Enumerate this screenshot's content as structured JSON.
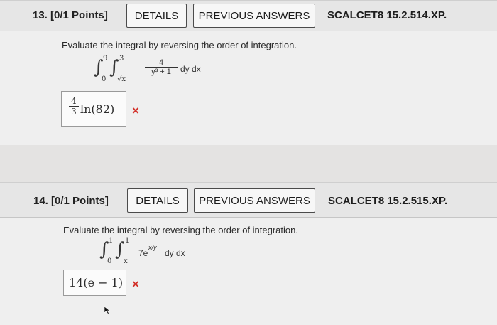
{
  "questions": [
    {
      "title": "13. [0/1 Points]",
      "details_label": "DETAILS",
      "prev_label": "PREVIOUS ANSWERS",
      "code": "SCALCET8 15.2.514.XP.",
      "prompt": "Evaluate the integral by reversing the order of integration.",
      "integral": {
        "outer_upper": "9",
        "outer_lower": "0",
        "inner_upper": "3",
        "inner_lower": "√x",
        "numerator": "4",
        "denominator": "y³ + 1",
        "differentials": "dy dx"
      },
      "answer": {
        "coef_num": "4",
        "coef_den": "3",
        "rest": "ln(82)"
      },
      "status": "incorrect"
    },
    {
      "title": "14. [0/1 Points]",
      "details_label": "DETAILS",
      "prev_label": "PREVIOUS ANSWERS",
      "code": "SCALCET8 15.2.515.XP.",
      "prompt": "Evaluate the integral by reversing the order of integration.",
      "integral": {
        "outer_upper": "1",
        "outer_lower": "0",
        "inner_upper": "1",
        "inner_lower": "x",
        "integrand": "7e",
        "exponent": "x/y",
        "differentials": "dy dx"
      },
      "answer": {
        "text": "14(e − 1)"
      },
      "status": "incorrect"
    }
  ],
  "incorrect_mark": "×",
  "integral_glyph": "∫",
  "colors": {
    "incorrect": "#d3322b",
    "header_bg": "#e6e6e6",
    "body_bg": "#efefef"
  }
}
